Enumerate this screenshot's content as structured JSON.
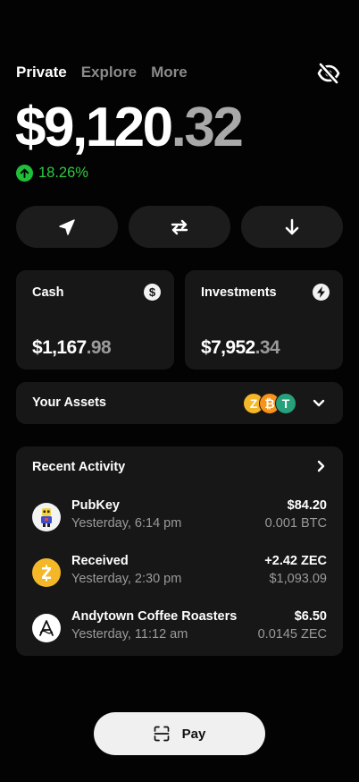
{
  "tabs": [
    {
      "label": "Private"
    },
    {
      "label": "Explore"
    },
    {
      "label": "More"
    }
  ],
  "balance": {
    "whole": "$9,120",
    "decimal": ".32"
  },
  "change": {
    "text": "18.26%"
  },
  "actions": [
    {
      "icon": "send-icon"
    },
    {
      "icon": "swap-icon"
    },
    {
      "icon": "receive-icon"
    }
  ],
  "cash": {
    "title": "Cash",
    "icon": "dollar-icon",
    "whole": "$1,167",
    "decimal": ".98"
  },
  "investments": {
    "title": "Investments",
    "icon": "lightning-icon",
    "whole": "$7,952",
    "decimal": ".34"
  },
  "assets": {
    "label": "Your Assets",
    "coins": [
      "Z",
      "₿",
      "T"
    ]
  },
  "recent": {
    "title": "Recent Activity",
    "items": [
      {
        "name": "PubKey",
        "time": "Yesterday, 6:14 pm",
        "amount": "$84.20",
        "sub": "0.001 BTC"
      },
      {
        "name": "Received",
        "time": "Yesterday, 2:30 pm",
        "amount": "+2.42 ZEC",
        "sub": "$1,093.09"
      },
      {
        "name": "Andytown Coffee Roasters",
        "time": "Yesterday, 11:12 am",
        "amount": "$6.50",
        "sub": "0.0145 ZEC"
      }
    ]
  },
  "pay": {
    "label": "Pay"
  },
  "colors": {
    "positive": "#2ecc40",
    "zcash": "#f4b728",
    "bitcoin": "#f7931a",
    "tether": "#26a17b"
  }
}
